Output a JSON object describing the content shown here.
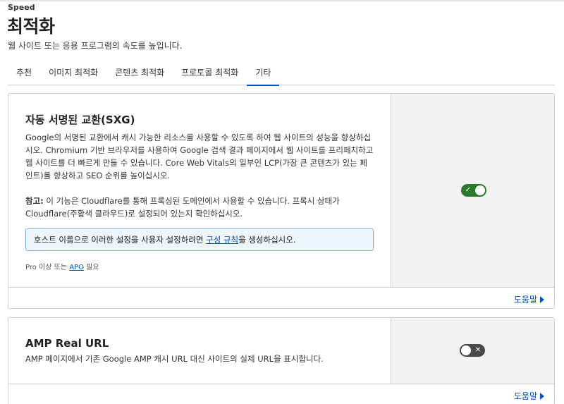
{
  "header": {
    "breadcrumb": "Speed",
    "title": "최적화",
    "subtitle": "웹 사이트 또는 응용 프로그램의 속도를 높입니다."
  },
  "tabs": [
    {
      "label": "추천",
      "active": false
    },
    {
      "label": "이미지 최적화",
      "active": false
    },
    {
      "label": "콘텐츠 최적화",
      "active": false
    },
    {
      "label": "프로토콜 최적화",
      "active": false
    },
    {
      "label": "기타",
      "active": true
    }
  ],
  "sxg": {
    "title": "자동 서명된 교환(SXG)",
    "description": "Google의 서명된 교환에서 캐시 가능한 리소스를 사용할 수 있도록 하여 웹 사이트의 성능을 향상하십시오. Chromium 기반 브라우저를 사용하여 Google 검색 결과 페이지에서 웹 사이트를 프리페치하고 웹 사이트를 더 빠르게 만들 수 있습니다. Core Web Vitals의 일부인 LCP(가장 큰 콘텐츠가 있는 페인트)를 향상하고 SEO 순위를 높이십시오.",
    "note_label": "참고:",
    "note_text": " 이 기능은 Cloudflare를 통해 프록싱된 도메인에서 사용할 수 있습니다. 프록시 상태가 Cloudflare(주황색 클라우드)로 설정되어 있는지 확인하십시오.",
    "info_prefix": "호스트 이름으로 이러한 설정을 사용자 설정하려면 ",
    "info_link": "구성 규칙",
    "info_suffix": "을 생성하십시오.",
    "req_prefix": "Pro 이상 또는 ",
    "req_link": "APO",
    "req_suffix": " 필요",
    "toggle_state": "on",
    "toggle_mark": "✓",
    "help": "도움말"
  },
  "amp": {
    "title": "AMP Real URL",
    "description": "AMP 페이지에서 기존 Google AMP 캐시 URL 대신 사이트의 실제 URL을 표시합니다.",
    "toggle_state": "off",
    "toggle_mark": "✕",
    "help": "도움말"
  },
  "colors": {
    "accent": "#0051c3",
    "toggle_on": "#2c7a2c",
    "toggle_off": "#4a4a4a",
    "info_bg": "#eef5fd",
    "info_border": "#7fb1ea"
  }
}
